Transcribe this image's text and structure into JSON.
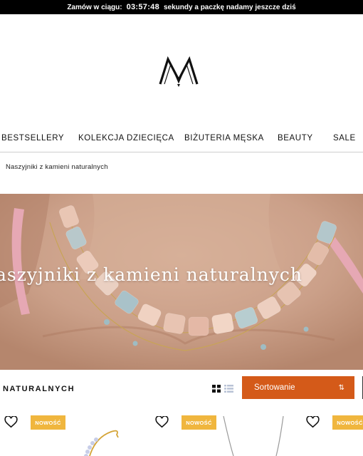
{
  "promo": {
    "prefix": "Zamów w ciągu:",
    "timer": "03:57:48",
    "suffix": "sekundy  a paczkę nadamy jeszcze dziś"
  },
  "nav": {
    "items": [
      {
        "label": "BESTSELLERY"
      },
      {
        "label": "KOLEKCJA DZIECIĘCA"
      },
      {
        "label": "BIŻUTERIA MĘSKA"
      },
      {
        "label": "BEAUTY"
      },
      {
        "label": "SALE"
      }
    ]
  },
  "breadcrumb": "Naszyjniki z kamieni naturalnych",
  "hero": {
    "title": "aszyjniki z kamieni naturalnych"
  },
  "listing": {
    "title": "NATURALNYCH",
    "sort_label": "Sortowanie",
    "sort_icon": "⇅"
  },
  "products": [
    {
      "badge": "NOWOŚĆ",
      "icon": "heart-icon"
    },
    {
      "badge": "NOWOŚĆ",
      "icon": "heart-icon"
    },
    {
      "badge": "NOWOŚĆ",
      "icon": "heart-icon"
    }
  ],
  "colors": {
    "accent": "#d45a19",
    "badge": "#f0b63e",
    "topbar": "#000000"
  }
}
